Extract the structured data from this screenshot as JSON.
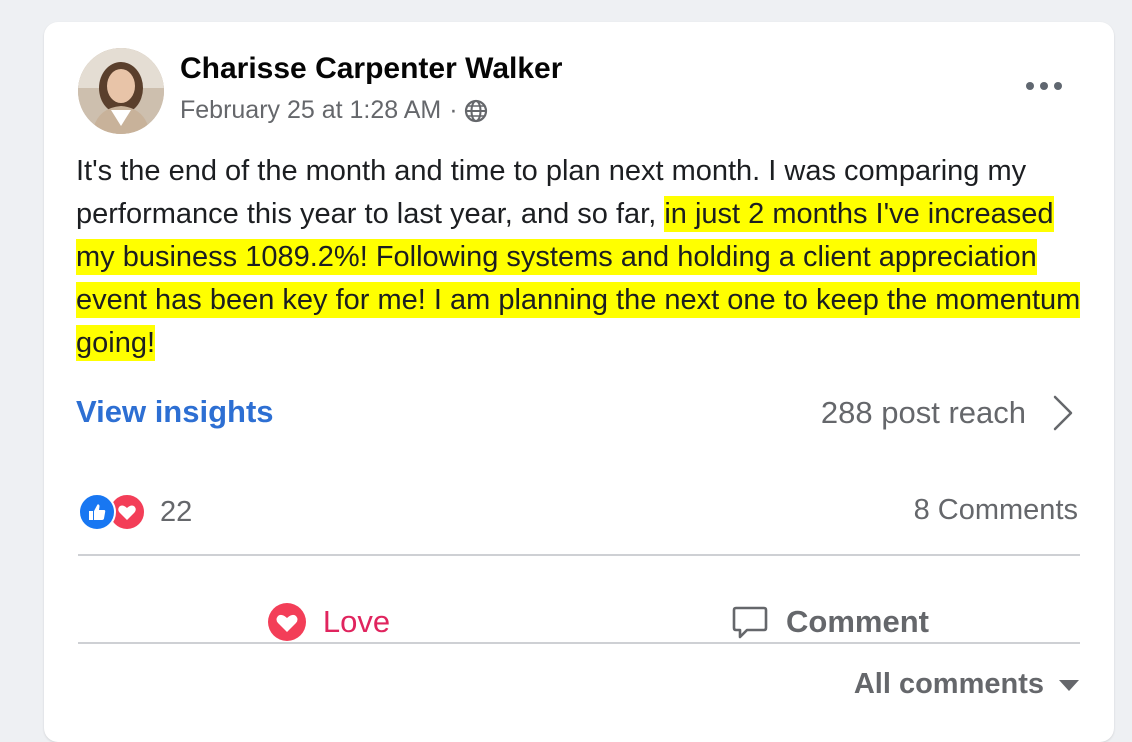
{
  "post": {
    "author": "Charisse Carpenter Walker",
    "timestamp": "February 25 at 1:28 AM",
    "separator": "·",
    "audience_icon": "globe-icon",
    "more_icon": "more-options-icon",
    "text_plain": "It's the end of the month and time to plan next month. I was comparing my performance this year to last year, and so far, ",
    "text_highlighted": "in just 2 months I've increased my business 1089.2%! Following systems and holding a client appreciation event has been key for me! I am planning the next one to keep the momentum going!",
    "highlight_color": "#ffff00"
  },
  "insights": {
    "view_label": "View insights",
    "reach_label": "288 post reach",
    "link_color": "#2d6fd3"
  },
  "reactions": {
    "icons": [
      "like-icon",
      "love-icon"
    ],
    "count": "22",
    "comments_label": "8 Comments"
  },
  "actions": {
    "love_label": "Love",
    "love_color": "#e0245e",
    "comment_label": "Comment"
  },
  "comments_filter": {
    "label": "All comments"
  }
}
